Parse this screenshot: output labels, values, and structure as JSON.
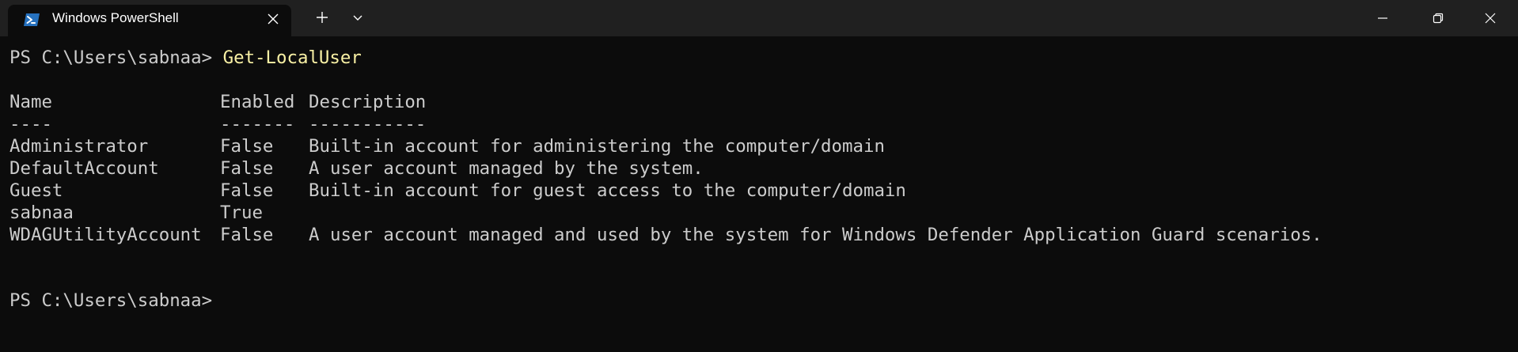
{
  "window": {
    "tab_title": "Windows PowerShell",
    "tab_icon": "powershell-icon",
    "new_tab_icon": "plus-icon",
    "dropdown_icon": "chevron-down-icon",
    "minimize_icon": "minimize-icon",
    "maximize_icon": "restore-icon",
    "close_icon": "close-icon"
  },
  "colors": {
    "background": "#0c0c0c",
    "titlebar": "#202020",
    "text": "#cccccc",
    "command": "#f9f1a5"
  },
  "terminal": {
    "prompt1": "PS C:\\Users\\sabnaa> ",
    "command1": "Get-LocalUser",
    "table": {
      "headers": [
        "Name",
        "Enabled",
        "Description"
      ],
      "separators": [
        "----",
        "-------",
        "-----------"
      ],
      "rows": [
        {
          "name": "Administrator",
          "enabled": "False",
          "description": "Built-in account for administering the computer/domain"
        },
        {
          "name": "DefaultAccount",
          "enabled": "False",
          "description": "A user account managed by the system."
        },
        {
          "name": "Guest",
          "enabled": "False",
          "description": "Built-in account for guest access to the computer/domain"
        },
        {
          "name": "sabnaa",
          "enabled": "True",
          "description": ""
        },
        {
          "name": "WDAGUtilityAccount",
          "enabled": "False",
          "description": "A user account managed and used by the system for Windows Defender Application Guard scenarios."
        }
      ]
    },
    "prompt2": "PS C:\\Users\\sabnaa>"
  }
}
